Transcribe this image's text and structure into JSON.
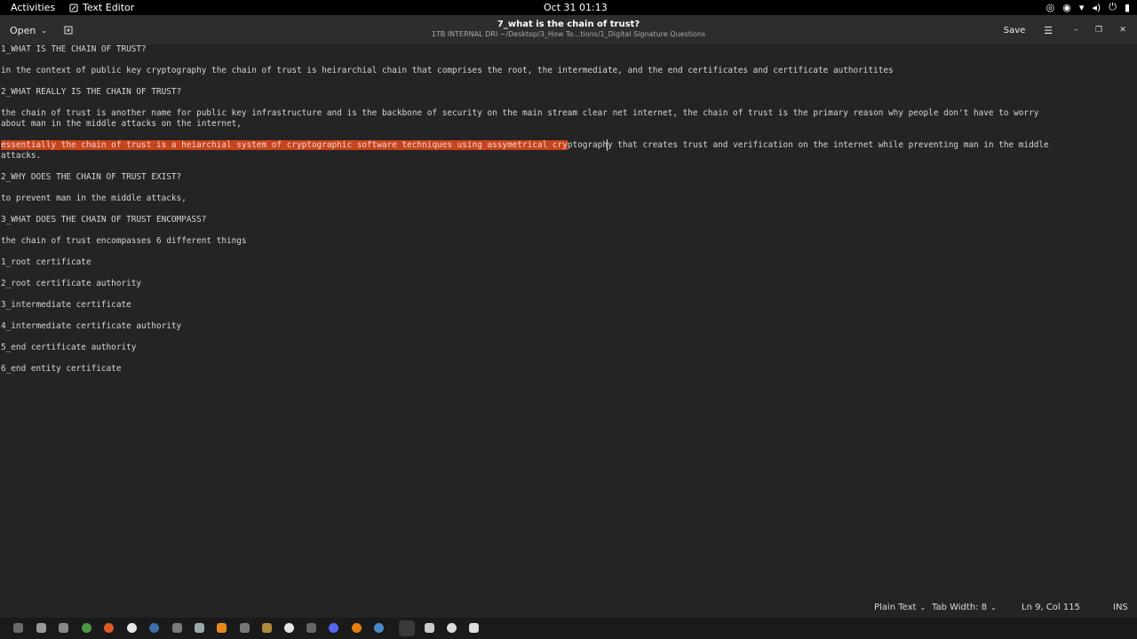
{
  "topbar": {
    "activities": "Activities",
    "app_name": "Text Editor",
    "clock": "Oct 31  01:13",
    "tray_icons": [
      "network-icon",
      "steam-icon",
      "wifi-icon",
      "volume-icon",
      "power-icon",
      "battery-icon"
    ]
  },
  "header": {
    "open_label": "Open",
    "title": "7_what is the chain of trust?",
    "subtitle": "1TB INTERNAL DRI ~/Desktop/3_How To…tions/1_Digital Signature Questions",
    "save_label": "Save"
  },
  "document": {
    "lines": [
      "1_WHAT IS THE CHAIN OF TRUST?",
      "in the context of public key cryptography the chain of trust is heirarchial chain that comprises the root, the intermediate, and the end certificates and certificate authoritites",
      "2_WHAT REALLY IS THE CHAIN OF TRUST?",
      "the chain of trust is another name for public key infrastructure and is the backbone of security on the main stream clear net internet, the chain of trust is the primary reason why people don't have to worry",
      "about man in the middle attacks on the internet,",
      "essentially the chain of trust is a heiarchial system of cryptographic software techniques using assymetrical cryptography that creates trust and verification on the internet while preventing man in the middle",
      "attacks.",
      "2_WHY DOES THE CHAIN OF TRUST EXIST?",
      "to prevent man in the middle attacks,",
      "3_WHAT DOES THE CHAIN OF TRUST ENCOMPASS?",
      "the chain of trust encompasses 6 different things",
      "1_root certificate",
      "2_root certificate authority",
      "3_intermediate certificate",
      "4_intermediate certificate authority",
      "5_end certificate authority",
      "6_end entity certificate"
    ],
    "selected_text": "essentially the chain of trust is a heiarchial system of cryptographic software techniques using assymetrical cry",
    "after_selection": "ptography that creates trust and verification on the internet while preventing man in the middle",
    "selection_color": "#c7441d"
  },
  "status": {
    "language": "Plain Text",
    "tab_width": "Tab Width: 8",
    "position": "Ln 9, Col 115",
    "mode": "INS"
  },
  "colors": {
    "background": "#242424",
    "header": "#2d2d2d",
    "topbar": "#000000"
  },
  "dock_icons": [
    "files-icon",
    "terminal-icon",
    "folder-icon",
    "chrome-icon",
    "firefox-icon",
    "github-icon",
    "steam-icon",
    "game-icon",
    "settings-icon",
    "vlc-icon",
    "torrent-icon",
    "clipboard-icon",
    "signal-icon",
    "calculator-icon",
    "discord-icon",
    "blender-icon",
    "browser-icon",
    "text-editor-icon",
    "document-icon",
    "disk-icon",
    "notes-icon"
  ]
}
